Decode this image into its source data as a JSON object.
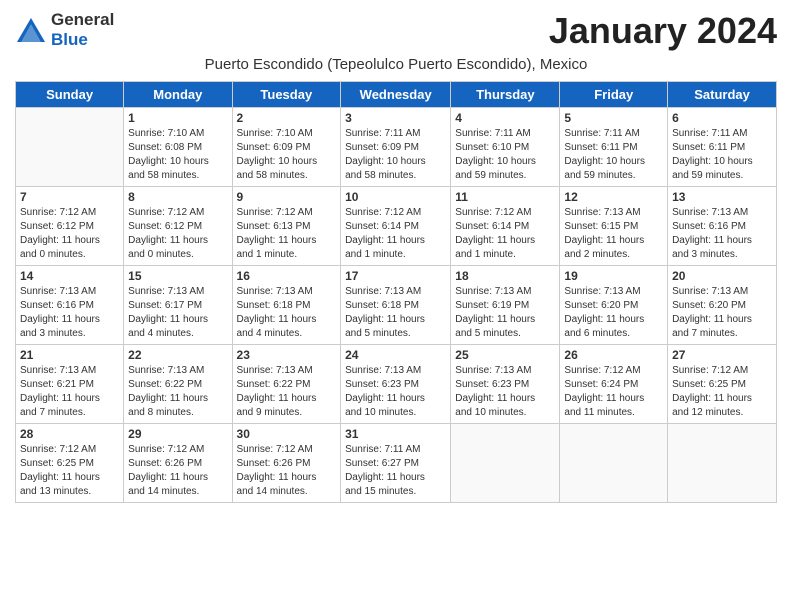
{
  "header": {
    "logo_general": "General",
    "logo_blue": "Blue",
    "month_title": "January 2024",
    "subtitle": "Puerto Escondido (Tepeolulco Puerto Escondido), Mexico"
  },
  "weekdays": [
    "Sunday",
    "Monday",
    "Tuesday",
    "Wednesday",
    "Thursday",
    "Friday",
    "Saturday"
  ],
  "weeks": [
    [
      {
        "day": "",
        "info": ""
      },
      {
        "day": "1",
        "info": "Sunrise: 7:10 AM\nSunset: 6:08 PM\nDaylight: 10 hours\nand 58 minutes."
      },
      {
        "day": "2",
        "info": "Sunrise: 7:10 AM\nSunset: 6:09 PM\nDaylight: 10 hours\nand 58 minutes."
      },
      {
        "day": "3",
        "info": "Sunrise: 7:11 AM\nSunset: 6:09 PM\nDaylight: 10 hours\nand 58 minutes."
      },
      {
        "day": "4",
        "info": "Sunrise: 7:11 AM\nSunset: 6:10 PM\nDaylight: 10 hours\nand 59 minutes."
      },
      {
        "day": "5",
        "info": "Sunrise: 7:11 AM\nSunset: 6:11 PM\nDaylight: 10 hours\nand 59 minutes."
      },
      {
        "day": "6",
        "info": "Sunrise: 7:11 AM\nSunset: 6:11 PM\nDaylight: 10 hours\nand 59 minutes."
      }
    ],
    [
      {
        "day": "7",
        "info": "Sunrise: 7:12 AM\nSunset: 6:12 PM\nDaylight: 11 hours\nand 0 minutes."
      },
      {
        "day": "8",
        "info": "Sunrise: 7:12 AM\nSunset: 6:12 PM\nDaylight: 11 hours\nand 0 minutes."
      },
      {
        "day": "9",
        "info": "Sunrise: 7:12 AM\nSunset: 6:13 PM\nDaylight: 11 hours\nand 1 minute."
      },
      {
        "day": "10",
        "info": "Sunrise: 7:12 AM\nSunset: 6:14 PM\nDaylight: 11 hours\nand 1 minute."
      },
      {
        "day": "11",
        "info": "Sunrise: 7:12 AM\nSunset: 6:14 PM\nDaylight: 11 hours\nand 1 minute."
      },
      {
        "day": "12",
        "info": "Sunrise: 7:13 AM\nSunset: 6:15 PM\nDaylight: 11 hours\nand 2 minutes."
      },
      {
        "day": "13",
        "info": "Sunrise: 7:13 AM\nSunset: 6:16 PM\nDaylight: 11 hours\nand 3 minutes."
      }
    ],
    [
      {
        "day": "14",
        "info": "Sunrise: 7:13 AM\nSunset: 6:16 PM\nDaylight: 11 hours\nand 3 minutes."
      },
      {
        "day": "15",
        "info": "Sunrise: 7:13 AM\nSunset: 6:17 PM\nDaylight: 11 hours\nand 4 minutes."
      },
      {
        "day": "16",
        "info": "Sunrise: 7:13 AM\nSunset: 6:18 PM\nDaylight: 11 hours\nand 4 minutes."
      },
      {
        "day": "17",
        "info": "Sunrise: 7:13 AM\nSunset: 6:18 PM\nDaylight: 11 hours\nand 5 minutes."
      },
      {
        "day": "18",
        "info": "Sunrise: 7:13 AM\nSunset: 6:19 PM\nDaylight: 11 hours\nand 5 minutes."
      },
      {
        "day": "19",
        "info": "Sunrise: 7:13 AM\nSunset: 6:20 PM\nDaylight: 11 hours\nand 6 minutes."
      },
      {
        "day": "20",
        "info": "Sunrise: 7:13 AM\nSunset: 6:20 PM\nDaylight: 11 hours\nand 7 minutes."
      }
    ],
    [
      {
        "day": "21",
        "info": "Sunrise: 7:13 AM\nSunset: 6:21 PM\nDaylight: 11 hours\nand 7 minutes."
      },
      {
        "day": "22",
        "info": "Sunrise: 7:13 AM\nSunset: 6:22 PM\nDaylight: 11 hours\nand 8 minutes."
      },
      {
        "day": "23",
        "info": "Sunrise: 7:13 AM\nSunset: 6:22 PM\nDaylight: 11 hours\nand 9 minutes."
      },
      {
        "day": "24",
        "info": "Sunrise: 7:13 AM\nSunset: 6:23 PM\nDaylight: 11 hours\nand 10 minutes."
      },
      {
        "day": "25",
        "info": "Sunrise: 7:13 AM\nSunset: 6:23 PM\nDaylight: 11 hours\nand 10 minutes."
      },
      {
        "day": "26",
        "info": "Sunrise: 7:12 AM\nSunset: 6:24 PM\nDaylight: 11 hours\nand 11 minutes."
      },
      {
        "day": "27",
        "info": "Sunrise: 7:12 AM\nSunset: 6:25 PM\nDaylight: 11 hours\nand 12 minutes."
      }
    ],
    [
      {
        "day": "28",
        "info": "Sunrise: 7:12 AM\nSunset: 6:25 PM\nDaylight: 11 hours\nand 13 minutes."
      },
      {
        "day": "29",
        "info": "Sunrise: 7:12 AM\nSunset: 6:26 PM\nDaylight: 11 hours\nand 14 minutes."
      },
      {
        "day": "30",
        "info": "Sunrise: 7:12 AM\nSunset: 6:26 PM\nDaylight: 11 hours\nand 14 minutes."
      },
      {
        "day": "31",
        "info": "Sunrise: 7:11 AM\nSunset: 6:27 PM\nDaylight: 11 hours\nand 15 minutes."
      },
      {
        "day": "",
        "info": ""
      },
      {
        "day": "",
        "info": ""
      },
      {
        "day": "",
        "info": ""
      }
    ]
  ]
}
